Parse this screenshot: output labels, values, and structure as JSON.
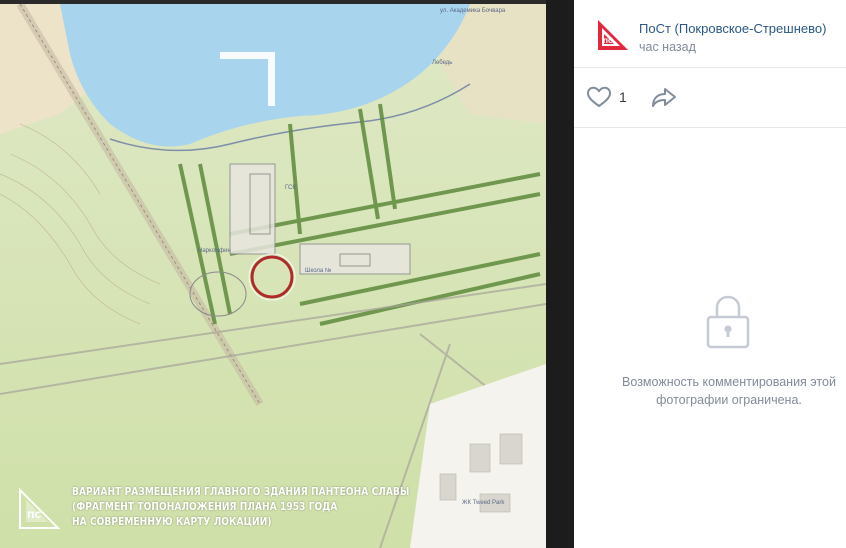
{
  "photo": {
    "caption": {
      "line1": "ВАРИАНТ РАЗМЕЩЕНИЯ ГЛАВНОГО ЗДАНИЯ ПАНТЕОНА СЛАВЫ",
      "line2": "(ФРАГМЕНТ ТОПОНАЛОЖЕНИЯ ПЛАНА 1953 ГОДА",
      "line3": "НА СОВРЕМЕННУЮ КАРТУ ЛОКАЦИИ)"
    },
    "map_labels": {
      "label1": "Лебедь",
      "label2": "Наркомфин",
      "label3": "Школа №",
      "label4": "ЖК Tweed Park",
      "label5": "ГСК",
      "label6": "ул. Академика Бочвара"
    }
  },
  "post": {
    "author": "ПоСт (Покровское-Стрешнево)",
    "time": "час назад",
    "likes": "1"
  },
  "comments": {
    "closed_message_line1": "Возможность комментирования этой",
    "closed_message_line2": "фотографии ограничена."
  },
  "colors": {
    "accent": "#2a5885",
    "muted": "#818c99",
    "brand_red": "#e3273c",
    "water": "#a9d4ee",
    "green": "#c9dca2"
  }
}
